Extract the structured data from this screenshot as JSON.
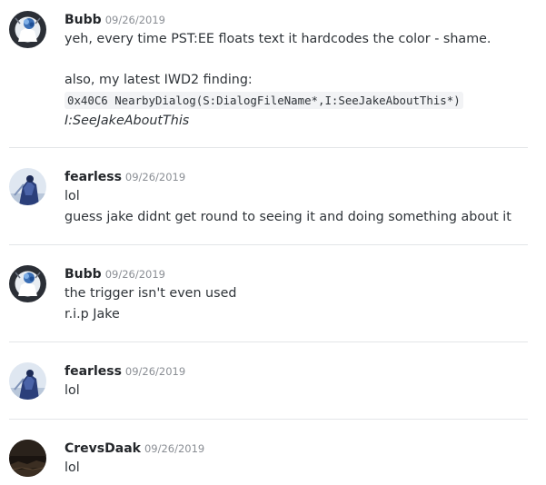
{
  "messages": [
    {
      "username": "Bubb",
      "timestamp": "09/26/2019",
      "line1": "yeh, every time PST:EE floats text it hardcodes the color - shame.",
      "line2": "also, my latest IWD2 finding:",
      "code": "0x40C6 NearbyDialog(S:DialogFileName*,I:SeeJakeAboutThis*)",
      "italic": "I:SeeJakeAboutThis"
    },
    {
      "username": "fearless",
      "timestamp": "09/26/2019",
      "line1": "lol",
      "line2": "guess jake didnt get round to seeing it and doing something about it"
    },
    {
      "username": "Bubb",
      "timestamp": "09/26/2019",
      "line1": "the trigger isn't even used",
      "line2": "r.i.p Jake"
    },
    {
      "username": "fearless",
      "timestamp": "09/26/2019",
      "line1": "lol"
    },
    {
      "username": "CrevsDaak",
      "timestamp": "09/26/2019",
      "line1": "lol"
    }
  ],
  "colors": {
    "username": "#23262a",
    "timestamp": "#8a8e94",
    "text": "#2e3338",
    "divider": "#e3e5e8",
    "code_bg": "#f2f3f5"
  },
  "icons": {
    "bubb_avatar": "blue-flower-avatar-icon",
    "fearless_avatar": "armored-figure-avatar-icon",
    "crevsdaak_avatar": "dark-landscape-avatar-icon"
  }
}
